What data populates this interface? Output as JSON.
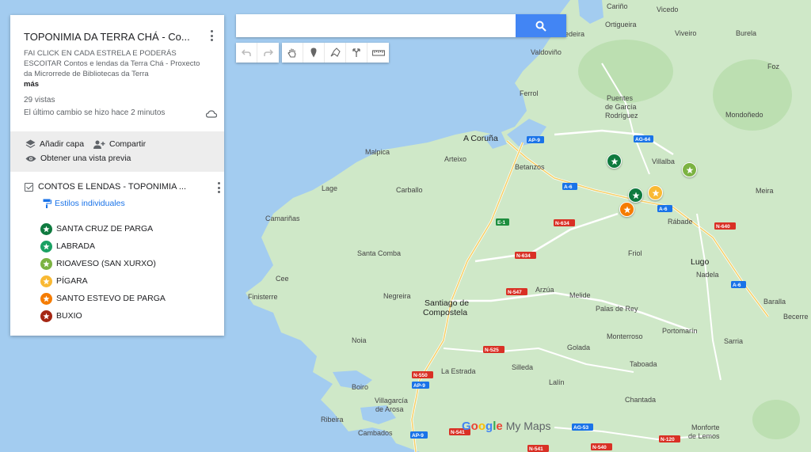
{
  "panel": {
    "title": "TOPONIMIA DA TERRA CHÁ - Co...",
    "description": "FAI CLICK EN CADA ESTRELA E PODERÁS ESCOITAR Contos e lendas da Terra Chá - Proxecto da Microrrede de Bibliotecas da Terra",
    "more": "más",
    "views": "29 vistas",
    "last_change": "El último cambio se hizo hace 2 minutos",
    "add_layer": "Añadir capa",
    "share": "Compartir",
    "preview": "Obtener una vista previa",
    "layer_name": "CONTOS E LENDAS - TOPONIMIA ...",
    "styles_link": "Estilos individuales",
    "legend": [
      {
        "label": "SANTA CRUZ DE PARGA",
        "color": "#0f7a3f"
      },
      {
        "label": "LABRADA",
        "color": "#1aa163"
      },
      {
        "label": "RIOAVESO (SAN XURXO)",
        "color": "#7cb342"
      },
      {
        "label": "PÍGARA",
        "color": "#f9b934"
      },
      {
        "label": "SANTO ESTEVO DE PARGA",
        "color": "#f57c00"
      },
      {
        "label": "BUXIO",
        "color": "#a52714"
      }
    ]
  },
  "search": {
    "value": "",
    "placeholder": ""
  },
  "toolbar": [
    "undo-icon",
    "redo-icon",
    "hand-icon",
    "marker-icon",
    "draw-line-icon",
    "directions-icon",
    "ruler-icon"
  ],
  "map": {
    "places": {
      "carino": "Cariño",
      "vicedo": "Vicedo",
      "ortigueira": "Ortigueira",
      "viveiro": "Viveiro",
      "burela": "Burela",
      "foz": "Foz",
      "cedeira": "edeira",
      "valdovino": "Valdoviño",
      "ferrol": "Ferrol",
      "puentes": "Puentes de García Rodríguez",
      "mondonedo": "Mondoñedo",
      "acoruna": "A Coruña",
      "malpica": "Malpica",
      "arteixo": "Arteixo",
      "betanzos": "Betanzos",
      "villalba": "Villalba",
      "lage": "Lage",
      "carballo": "Carballo",
      "meira": "Meira",
      "camarinas": "Camariñas",
      "rabade": "Rábade",
      "santacomba": "Santa Comba",
      "friol": "Friol",
      "lugo": "Lugo",
      "cee": "Cee",
      "nadela": "Nadela",
      "finisterre": "Finisterre",
      "negreira": "Negreira",
      "santiago": "Santiago de Compostela",
      "arzua": "Arzúa",
      "melide": "Melide",
      "palas": "Palas de Rey",
      "baralla": "Baralla",
      "becerre": "Becerre",
      "portomarin": "Portomarín",
      "noia": "Noia",
      "monterroso": "Monterroso",
      "sarria": "Sarria",
      "golada": "Golada",
      "silleda": "Silleda",
      "laestrada": "La Estrada",
      "taboada": "Taboada",
      "boiro": "Boiro",
      "lalin": "Lalín",
      "villagarcia": "Villagarcía de Arosa",
      "chantada": "Chantada",
      "ribeira": "Ribeira",
      "cambados": "Cambados",
      "monforte": "Monforte de Lemos"
    },
    "roads": {
      "ap9a": "AP-9",
      "ag64": "AG-64",
      "a6a": "A-6",
      "a6b": "A-6",
      "e1": "E-1",
      "n634a": "N-634",
      "n634b": "N-634",
      "n640": "N-640",
      "n547": "N-547",
      "a6c": "A-6",
      "n525": "N-525",
      "n550": "N-550",
      "ap9b": "AP-9",
      "ap9c": "AP-9",
      "n541a": "N-541",
      "ag53": "AG-53",
      "n541b": "N-541",
      "n540": "N-540",
      "n120": "N-120"
    }
  },
  "logo": {
    "google": "Google",
    "mymaps": "My Maps"
  }
}
